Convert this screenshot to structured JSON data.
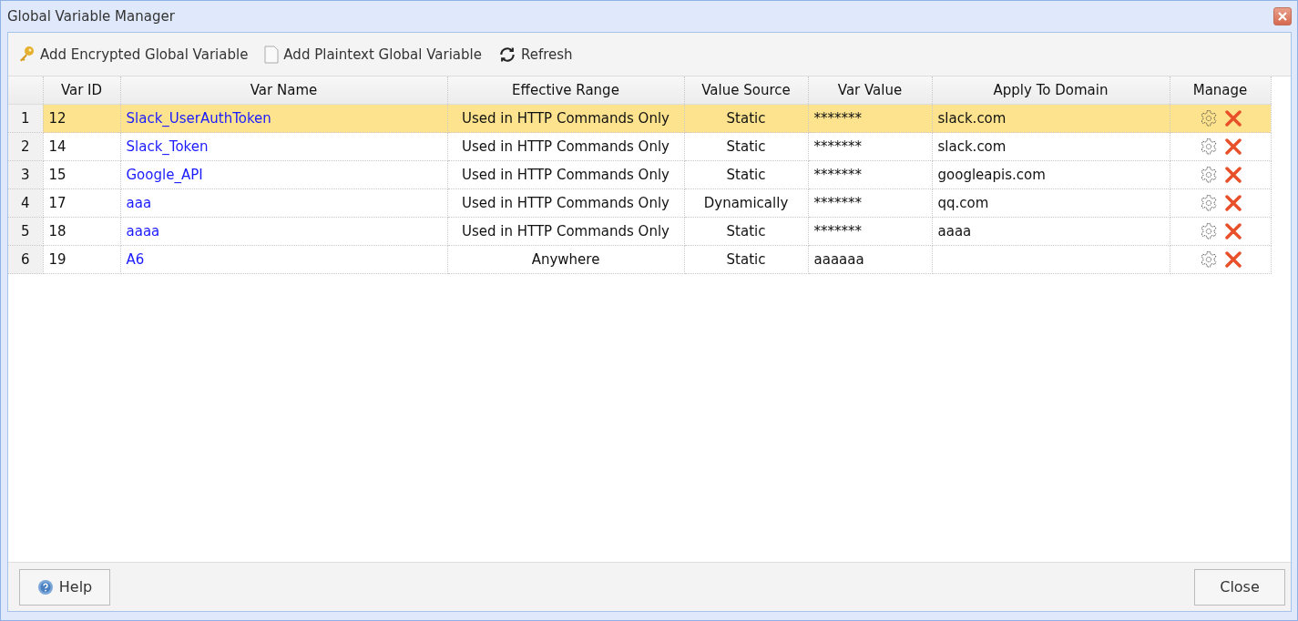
{
  "window": {
    "title": "Global Variable Manager"
  },
  "toolbar": [
    "Add Encrypted Global Variable",
    "Add Plaintext Global Variable",
    "Refresh"
  ],
  "table": {
    "columns": [
      "Var ID",
      "Var Name",
      "Effective Range",
      "Value Source",
      "Var Value",
      "Apply To Domain",
      "Manage"
    ],
    "rows": [
      {
        "number": "1",
        "id": "12",
        "name": "Slack_UserAuthToken",
        "range": "Used in HTTP Commands Only",
        "source": "Static",
        "value": "*******",
        "domain": "slack.com",
        "selected": true
      },
      {
        "number": "2",
        "id": "14",
        "name": "Slack_Token",
        "range": "Used in HTTP Commands Only",
        "source": "Static",
        "value": "*******",
        "domain": "slack.com",
        "selected": false
      },
      {
        "number": "3",
        "id": "15",
        "name": "Google_API",
        "range": "Used in HTTP Commands Only",
        "source": "Static",
        "value": "*******",
        "domain": "googleapis.com",
        "selected": false
      },
      {
        "number": "4",
        "id": "17",
        "name": "aaa",
        "range": "Used in HTTP Commands Only",
        "source": "Dynamically",
        "value": "*******",
        "domain": "qq.com",
        "selected": false
      },
      {
        "number": "5",
        "id": "18",
        "name": "aaaa",
        "range": "Used in HTTP Commands Only",
        "source": "Static",
        "value": "*******",
        "domain": "aaaa",
        "selected": false
      },
      {
        "number": "6",
        "id": "19",
        "name": "A6",
        "range": "Anywhere",
        "source": "Static",
        "value": "aaaaaa",
        "selected": false
      }
    ]
  },
  "buttons": [
    "Help",
    "Close"
  ]
}
